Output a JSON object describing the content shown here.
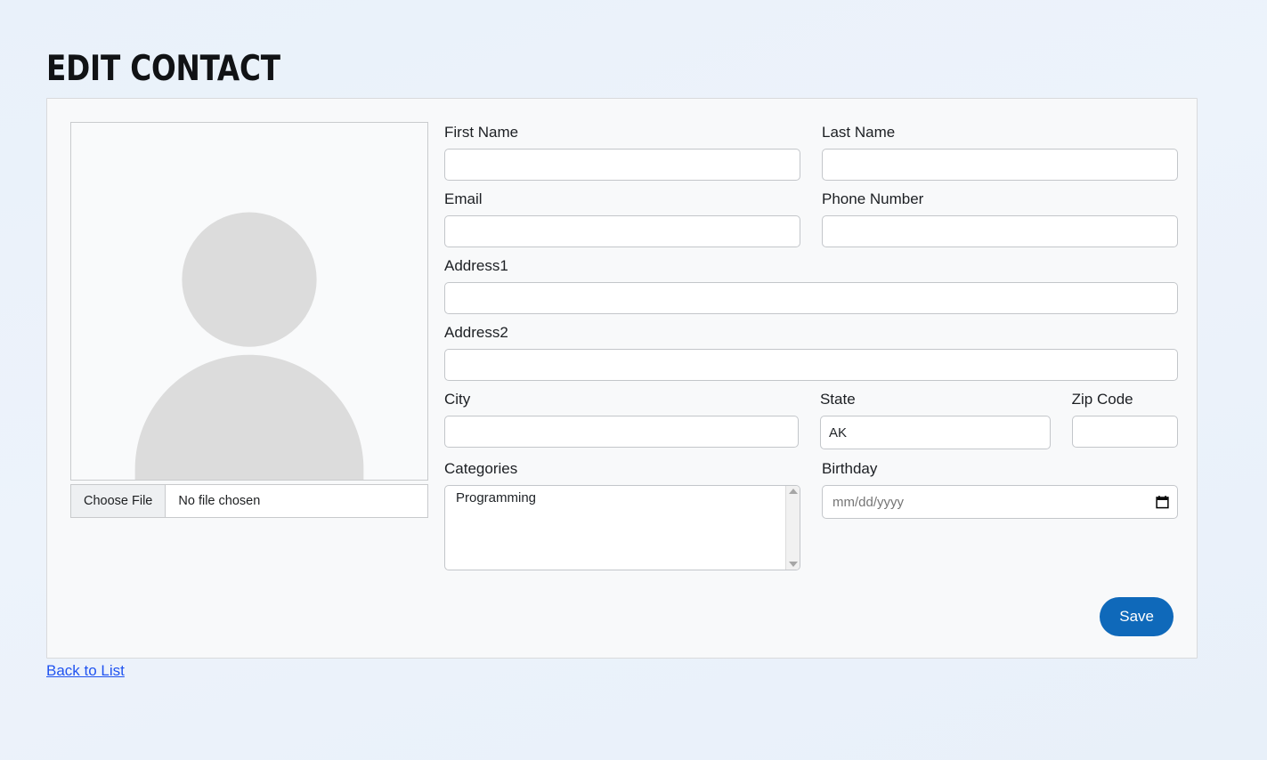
{
  "page": {
    "title": "EDIT CONTACT",
    "background_color": "#eaf2fa",
    "card_background": "#f8f9fa"
  },
  "photo": {
    "avatar_alt": "person-placeholder",
    "file_button_label": "Choose File",
    "file_status": "No file chosen"
  },
  "form": {
    "first_name": {
      "label": "First Name",
      "value": "",
      "placeholder": ""
    },
    "last_name": {
      "label": "Last Name",
      "value": "",
      "placeholder": ""
    },
    "email": {
      "label": "Email",
      "value": "",
      "placeholder": ""
    },
    "phone_number": {
      "label": "Phone Number",
      "value": "",
      "placeholder": ""
    },
    "address1": {
      "label": "Address1",
      "value": "",
      "placeholder": ""
    },
    "address2": {
      "label": "Address2",
      "value": "",
      "placeholder": ""
    },
    "city": {
      "label": "City",
      "value": "",
      "placeholder": ""
    },
    "state": {
      "label": "State",
      "selected": "AK",
      "options": [
        "AK"
      ]
    },
    "zip_code": {
      "label": "Zip Code",
      "value": "",
      "placeholder": ""
    },
    "categories": {
      "label": "Categories",
      "options": [
        "Programming"
      ],
      "selected": []
    },
    "birthday": {
      "label": "Birthday",
      "value": "",
      "placeholder": "mm/dd/yyyy"
    }
  },
  "actions": {
    "save_label": "Save",
    "save_color": "#0f69ba",
    "back_link_label": "Back to List",
    "link_color": "#2053f0"
  }
}
